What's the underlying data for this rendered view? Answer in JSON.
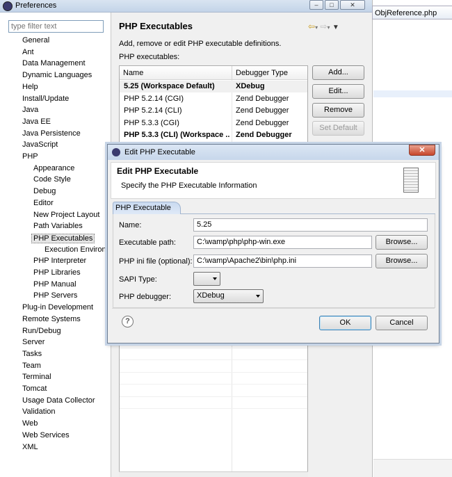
{
  "window": {
    "title": "Preferences",
    "bg_tab": "ObjReference.php"
  },
  "filter": {
    "placeholder": "type filter text"
  },
  "tree": [
    {
      "label": "General",
      "level": 0
    },
    {
      "label": "Ant",
      "level": 0
    },
    {
      "label": "Data Management",
      "level": 0
    },
    {
      "label": "Dynamic Languages",
      "level": 0
    },
    {
      "label": "Help",
      "level": 0
    },
    {
      "label": "Install/Update",
      "level": 0
    },
    {
      "label": "Java",
      "level": 0
    },
    {
      "label": "Java EE",
      "level": 0
    },
    {
      "label": "Java Persistence",
      "level": 0
    },
    {
      "label": "JavaScript",
      "level": 0
    },
    {
      "label": "PHP",
      "level": 0
    },
    {
      "label": "Appearance",
      "level": 1
    },
    {
      "label": "Code Style",
      "level": 1
    },
    {
      "label": "Debug",
      "level": 1
    },
    {
      "label": "Editor",
      "level": 1
    },
    {
      "label": "New Project Layout",
      "level": 1
    },
    {
      "label": "Path Variables",
      "level": 1
    },
    {
      "label": "PHP Executables",
      "level": 1,
      "selected": true
    },
    {
      "label": "Execution Environ",
      "level": 2
    },
    {
      "label": "PHP Interpreter",
      "level": 1
    },
    {
      "label": "PHP Libraries",
      "level": 1
    },
    {
      "label": "PHP Manual",
      "level": 1
    },
    {
      "label": "PHP Servers",
      "level": 1
    },
    {
      "label": "Plug-in Development",
      "level": 0
    },
    {
      "label": "Remote Systems",
      "level": 0
    },
    {
      "label": "Run/Debug",
      "level": 0
    },
    {
      "label": "Server",
      "level": 0
    },
    {
      "label": "Tasks",
      "level": 0
    },
    {
      "label": "Team",
      "level": 0
    },
    {
      "label": "Terminal",
      "level": 0
    },
    {
      "label": "Tomcat",
      "level": 0
    },
    {
      "label": "Usage Data Collector",
      "level": 0
    },
    {
      "label": "Validation",
      "level": 0
    },
    {
      "label": "Web",
      "level": 0
    },
    {
      "label": "Web Services",
      "level": 0
    },
    {
      "label": "XML",
      "level": 0
    }
  ],
  "page": {
    "title": "PHP Executables",
    "description": "Add, remove or edit PHP executable definitions.",
    "list_label": "PHP executables:"
  },
  "table": {
    "headers": [
      "Name",
      "Debugger Type"
    ],
    "rows": [
      {
        "name": "5.25 (Workspace Default)",
        "debugger": "XDebug",
        "bold": true
      },
      {
        "name": "PHP 5.2.14 (CGI)",
        "debugger": "Zend Debugger",
        "bold": false
      },
      {
        "name": "PHP 5.2.14 (CLI)",
        "debugger": "Zend Debugger",
        "bold": false
      },
      {
        "name": "PHP 5.3.3 (CGI)",
        "debugger": "Zend Debugger",
        "bold": false
      },
      {
        "name": "PHP 5.3.3 (CLI) (Workspace ...",
        "debugger": "Zend Debugger",
        "bold": true
      }
    ]
  },
  "buttons": {
    "add": "Add...",
    "edit": "Edit...",
    "remove": "Remove",
    "set_default": "Set Default"
  },
  "dialog": {
    "title": "Edit PHP Executable",
    "heading": "Edit PHP Executable",
    "subheading": "Specify the PHP Executable Information",
    "tab": "PHP Executable",
    "name_label": "Name:",
    "name_value": "5.25",
    "exe_label": "Executable path:",
    "exe_value": "C:\\wamp\\php\\php-win.exe",
    "ini_label": "PHP ini file (optional):",
    "ini_value": "C:\\wamp\\Apache2\\bin\\php.ini",
    "sapi_label": "SAPI Type:",
    "sapi_value": "",
    "debugger_label": "PHP debugger:",
    "debugger_value": "XDebug",
    "browse": "Browse...",
    "ok": "OK",
    "cancel": "Cancel",
    "help": "?"
  }
}
